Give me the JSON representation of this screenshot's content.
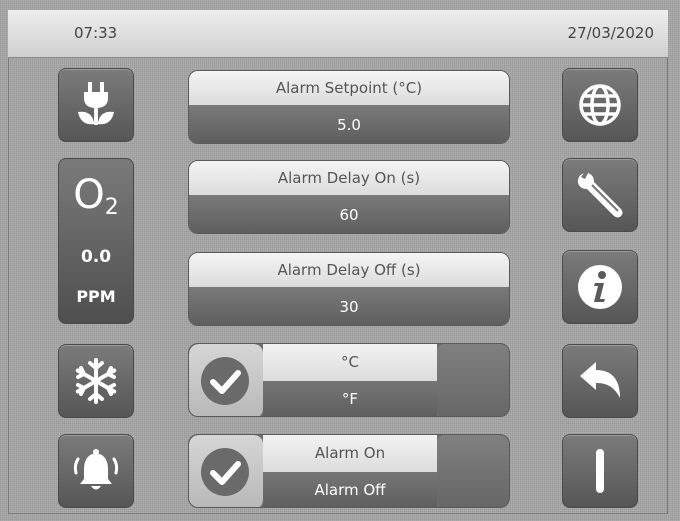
{
  "status_bar": {
    "time": "07:33",
    "date": "27/03/2020"
  },
  "left_column": {
    "power_eco_icon": "plug-leaf-icon",
    "o2": {
      "label_main": "O",
      "label_sub": "2",
      "value": "0.0",
      "unit": "PPM"
    },
    "defrost_icon": "snowflake-icon",
    "alarm_icon": "bell-icon"
  },
  "settings": [
    {
      "label": "Alarm Setpoint (°C)",
      "value": "5.0"
    },
    {
      "label": "Alarm Delay On (s)",
      "value": "60"
    },
    {
      "label": "Alarm Delay Off (s)",
      "value": "30"
    }
  ],
  "toggles": [
    {
      "option_1": "°C",
      "option_2": "°F"
    },
    {
      "option_1": "Alarm On",
      "option_2": "Alarm Off"
    }
  ],
  "right_column": {
    "language_icon": "globe-icon",
    "service_icon": "wrench-icon",
    "info_icon": "info-icon",
    "back_icon": "back-arrow-icon",
    "power_icon": "power-bar-icon"
  }
}
